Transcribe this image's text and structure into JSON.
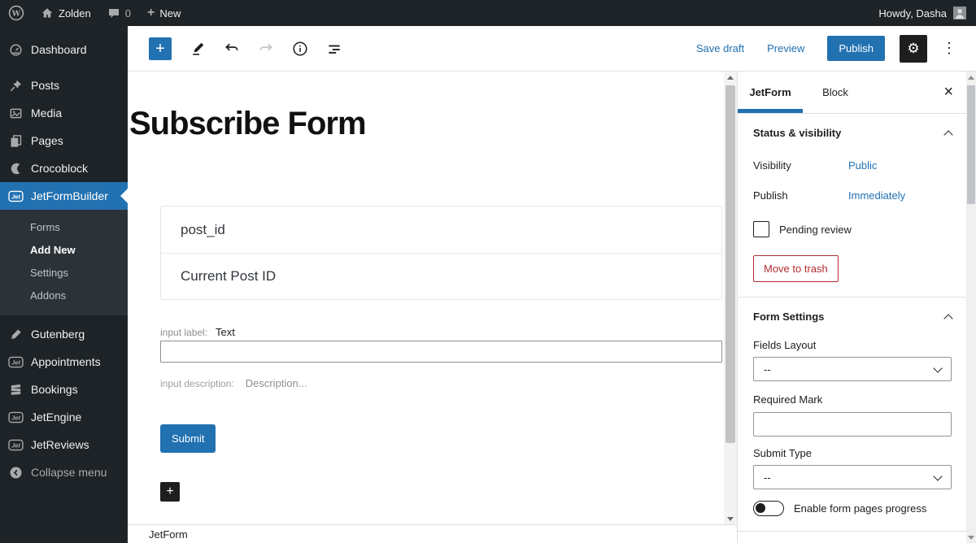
{
  "colors": {
    "accent": "#2271b1",
    "danger": "#b32d2e",
    "dark_ui": "#1e1e1e",
    "adminbar_bg": "#1d2327",
    "submenu_bg": "#2c3338"
  },
  "admin_bar": {
    "wp_glyph": "W",
    "site_name": "Zolden",
    "comments_count": "0",
    "plus_glyph": "+",
    "new_label": "New",
    "howdy": "Howdy, Dasha"
  },
  "sidebar": {
    "items": [
      {
        "label": "Dashboard"
      },
      {
        "label": "Posts"
      },
      {
        "label": "Media"
      },
      {
        "label": "Pages"
      },
      {
        "label": "Crocoblock"
      },
      {
        "label": "JetFormBuilder"
      }
    ],
    "submenu": [
      {
        "label": "Forms"
      },
      {
        "label": "Add New"
      },
      {
        "label": "Settings"
      },
      {
        "label": "Addons"
      }
    ],
    "plugin_items": [
      {
        "label": "Gutenberg"
      },
      {
        "label": "Appointments"
      },
      {
        "label": "Bookings"
      },
      {
        "label": "JetEngine"
      },
      {
        "label": "JetReviews"
      }
    ],
    "collapse_label": "Collapse menu",
    "jet_badge": "Jet"
  },
  "editor_header": {
    "inserter_glyph": "+",
    "save_draft": "Save draft",
    "preview": "Preview",
    "publish": "Publish",
    "settings_glyph": "⚙",
    "options_glyph": "⋮"
  },
  "canvas": {
    "title": "Subscribe Form",
    "field_box": {
      "name": "post_id",
      "value": "Current Post ID"
    },
    "input_label_prefix": "input label:",
    "input_label": "Text",
    "input_value": "",
    "input_description_prefix": "input description:",
    "input_description_placeholder": "Description...",
    "submit_label": "Submit",
    "appender_glyph": "+",
    "breadcrumb": "JetForm"
  },
  "inspector": {
    "tab_jetform": "JetForm",
    "tab_block": "Block",
    "close_glyph": "×",
    "status_panel": {
      "title": "Status & visibility",
      "visibility_label": "Visibility",
      "visibility_value": "Public",
      "publish_label": "Publish",
      "publish_value": "Immediately",
      "pending_review_label": "Pending review",
      "move_to_trash": "Move to trash"
    },
    "form_settings": {
      "title": "Form Settings",
      "fields_layout_label": "Fields Layout",
      "fields_layout_value": "--",
      "required_mark_label": "Required Mark",
      "required_mark_value": "",
      "submit_type_label": "Submit Type",
      "submit_type_value": "--",
      "toggle_label": "Enable form pages progress"
    }
  }
}
